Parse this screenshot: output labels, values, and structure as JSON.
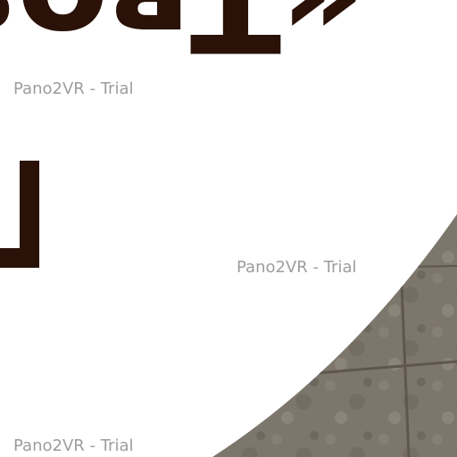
{
  "sign": {
    "text": "«Твоя"
  },
  "watermarks": [
    "Pano2VR - Trial",
    "Pano2VR - Trial",
    "Pano2VR - Trial"
  ],
  "colors": {
    "sign_text": "#2a1208",
    "floor_base": "#7d766c",
    "floor_grout": "#5e574e",
    "background": "#ffffff",
    "watermark": "#8c8c8c"
  }
}
